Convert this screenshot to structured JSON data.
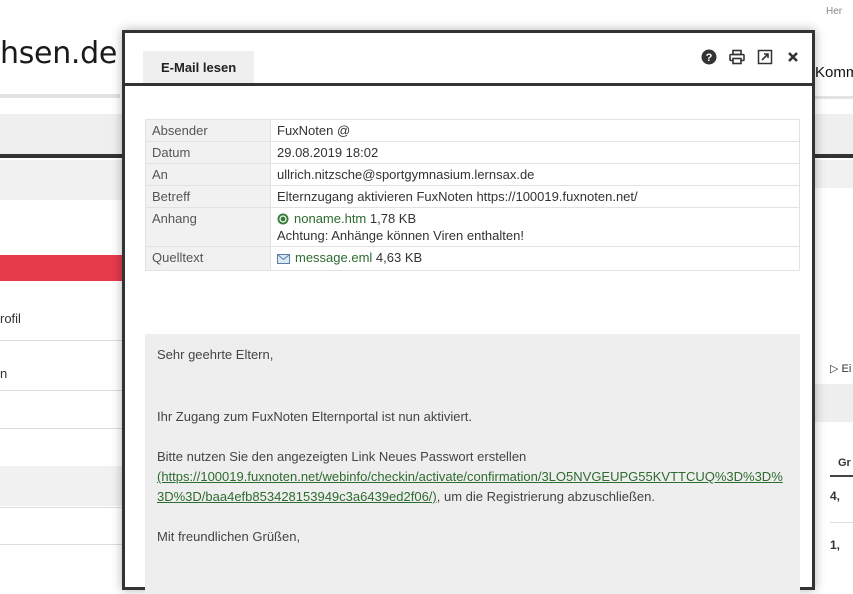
{
  "background": {
    "top_right_text": "Her",
    "logo_text": "hsen.de",
    "nav_items": [
      "rofil",
      "n"
    ],
    "right_title": "Komm",
    "right_link": "Ei",
    "right_header": "Gr",
    "right_cells": [
      "4,",
      "1,"
    ]
  },
  "modal": {
    "tab_label": "E-Mail lesen",
    "tools": [
      "help-icon",
      "print-icon",
      "open-external-icon",
      "close-icon"
    ],
    "meta": {
      "sender_label": "Absender",
      "sender_value": "FuxNoten @",
      "date_label": "Datum",
      "date_value": "29.08.2019 18:02",
      "to_label": "An",
      "to_value": "ullrich.nitzsche@sportgymnasium.lernsax.de",
      "subject_label": "Betreff",
      "subject_value": "Elternzugang aktivieren FuxNoten https://100019.fuxnoten.net/",
      "attachment_label": "Anhang",
      "attachment_file": "noname.htm",
      "attachment_size": " 1,78 KB",
      "attachment_warning": "Achtung: Anhänge können Viren enthalten!",
      "source_label": "Quelltext",
      "source_file": "message.eml",
      "source_size": " 4,63 KB"
    },
    "body": {
      "greeting": "Sehr geehrte Eltern,",
      "line1": "Ihr Zugang zum FuxNoten Elternportal ist nun aktiviert.",
      "line2": "Bitte nutzen Sie den angezeigten Link Neues Passwort erstellen",
      "link": "(https://100019.fuxnoten.net/webinfo/checkin/activate/confirmation/3LO5NVGEUPG55KVTTCUQ%3D%3D%3D%3D/baa4efb853428153949c3a6439ed2f06/)",
      "line2_end": ", um die Registrierung abzuschließen.",
      "closing": "Mit freundlichen Grüßen,"
    }
  },
  "colors": {
    "accent_red": "#e53a4c",
    "link_green": "#2e6b2f"
  }
}
